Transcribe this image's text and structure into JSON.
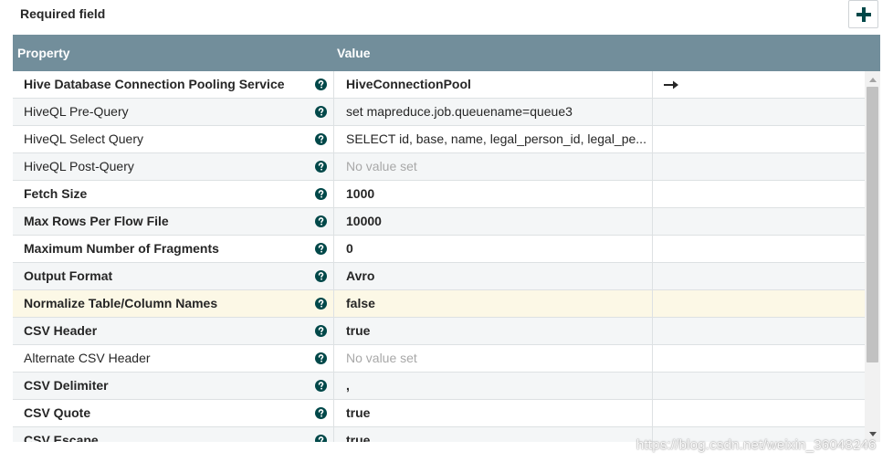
{
  "header": {
    "required_label": "Required field",
    "add_icon": "plus-icon"
  },
  "table": {
    "columns": [
      "Property",
      "Value"
    ],
    "rows": [
      {
        "name": "Hive Database Connection Pooling Service",
        "value": "HiveConnectionPool",
        "required": true,
        "empty": false,
        "action": "arrow-right-icon"
      },
      {
        "name": "HiveQL Pre-Query",
        "value": "set mapreduce.job.queuename=queue3",
        "required": false,
        "empty": false
      },
      {
        "name": "HiveQL Select Query",
        "value": "SELECT id, base, name, legal_person_id, legal_pe...",
        "required": false,
        "empty": false
      },
      {
        "name": "HiveQL Post-Query",
        "value": "No value set",
        "required": false,
        "empty": true
      },
      {
        "name": "Fetch Size",
        "value": "1000",
        "required": true,
        "empty": false
      },
      {
        "name": "Max Rows Per Flow File",
        "value": "10000",
        "required": true,
        "empty": false
      },
      {
        "name": "Maximum Number of Fragments",
        "value": "0",
        "required": true,
        "empty": false
      },
      {
        "name": "Output Format",
        "value": "Avro",
        "required": true,
        "empty": false
      },
      {
        "name": "Normalize Table/Column Names",
        "value": "false",
        "required": true,
        "empty": false,
        "highlighted": true
      },
      {
        "name": "CSV Header",
        "value": "true",
        "required": true,
        "empty": false
      },
      {
        "name": "Alternate CSV Header",
        "value": "No value set",
        "required": false,
        "empty": true
      },
      {
        "name": "CSV Delimiter",
        "value": ",",
        "required": true,
        "empty": false
      },
      {
        "name": "CSV Quote",
        "value": "true",
        "required": true,
        "empty": false
      },
      {
        "name": "CSV Escape",
        "value": "true",
        "required": true,
        "empty": false
      }
    ],
    "help_icon": "question-circle-icon"
  },
  "colors": {
    "header_bg": "#728e9b",
    "help_icon": "#004849",
    "add_icon": "#004849",
    "highlight_row": "#fcf8e6"
  },
  "watermark": "https://blog.csdn.net/weixin_36048246"
}
